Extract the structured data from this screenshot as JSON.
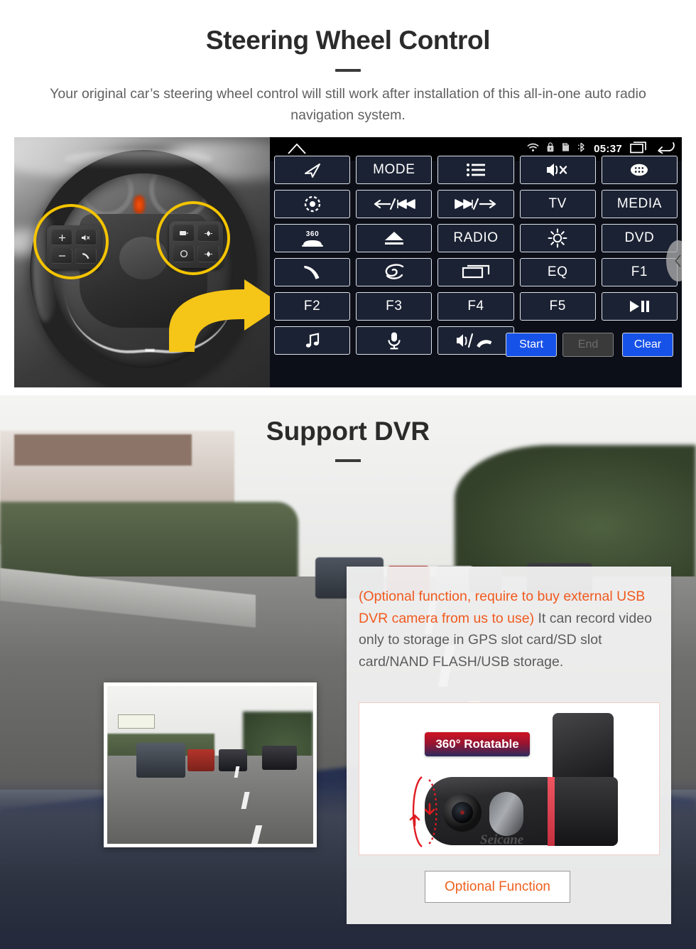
{
  "steering_section": {
    "title": "Steering Wheel Control",
    "subtitle": "Your original car’s steering wheel control will still work after installation of this all-in-one auto radio navigation system.",
    "status_bar": {
      "home_icon": "home-icon",
      "wifi_icon": "wifi-icon",
      "lock_icon": "lock-icon",
      "sdcard_icon": "sd-card-icon",
      "bluetooth_icon": "bluetooth-icon",
      "clock": "05:37",
      "recents_icon": "recents-icon",
      "back_icon": "back-icon"
    },
    "keypad_rows": [
      [
        {
          "label": "",
          "icon": "navigation-arrow-icon"
        },
        {
          "label": "MODE",
          "icon": ""
        },
        {
          "label": "",
          "icon": "list-menu-icon"
        },
        {
          "label": "",
          "icon": "mute-speaker-icon"
        },
        {
          "label": "",
          "icon": "apps-grid-icon"
        }
      ],
      [
        {
          "label": "",
          "icon": "power-eye-icon"
        },
        {
          "label": "",
          "icon": "prev-track-icon"
        },
        {
          "label": "",
          "icon": "next-track-icon"
        },
        {
          "label": "TV",
          "icon": ""
        },
        {
          "label": "MEDIA",
          "icon": ""
        }
      ],
      [
        {
          "label": "",
          "icon": "360-camera-icon"
        },
        {
          "label": "",
          "icon": "eject-icon"
        },
        {
          "label": "RADIO",
          "icon": ""
        },
        {
          "label": "",
          "icon": "brightness-icon"
        },
        {
          "label": "DVD",
          "icon": ""
        }
      ],
      [
        {
          "label": "",
          "icon": "phone-call-icon"
        },
        {
          "label": "",
          "icon": "swirl-icon"
        },
        {
          "label": "",
          "icon": "screen-window-icon"
        },
        {
          "label": "EQ",
          "icon": ""
        },
        {
          "label": "F1",
          "icon": ""
        }
      ],
      [
        {
          "label": "F2",
          "icon": ""
        },
        {
          "label": "F3",
          "icon": ""
        },
        {
          "label": "F4",
          "icon": ""
        },
        {
          "label": "F5",
          "icon": ""
        },
        {
          "label": "",
          "icon": "play-pause-icon"
        }
      ],
      [
        {
          "label": "",
          "icon": "music-note-icon"
        },
        {
          "label": "",
          "icon": "microphone-icon"
        },
        {
          "label": "",
          "icon": "volume-hangup-icon"
        },
        {
          "label": "",
          "icon": ""
        },
        {
          "label": "",
          "icon": ""
        }
      ]
    ],
    "actions": {
      "start": "Start",
      "end": "End",
      "clear": "Clear"
    },
    "side_handle_icon": "collapse-left-icon",
    "wheel_photo": {
      "left_cluster_keys": [
        "+",
        "−",
        "mute-icon",
        "phone-icon"
      ],
      "right_cluster_keys": [
        "source-icon",
        "diamond-up-icon",
        "circle-icon",
        "diamond-down-icon"
      ],
      "highlight_color": "#f4c400",
      "arrow_color": "#f5c518"
    }
  },
  "dvr_section": {
    "title": "Support DVR",
    "notice_warning": "(Optional function, require to buy external USB DVR camera from us to use)",
    "notice_body": "It can record video only to storage in GPS slot card/SD slot card/NAND FLASH/USB storage.",
    "badge": "360° Rotatable",
    "brand": "Seicane",
    "optional_button": "Optional Function",
    "colors": {
      "warning": "#f05a1e",
      "body_text": "#5c5c5c",
      "button_text": "#f0601e",
      "badge_red": "#cf1322",
      "badge_navy": "#2b2a5e",
      "rotation_arrow": "#e01b22"
    }
  }
}
